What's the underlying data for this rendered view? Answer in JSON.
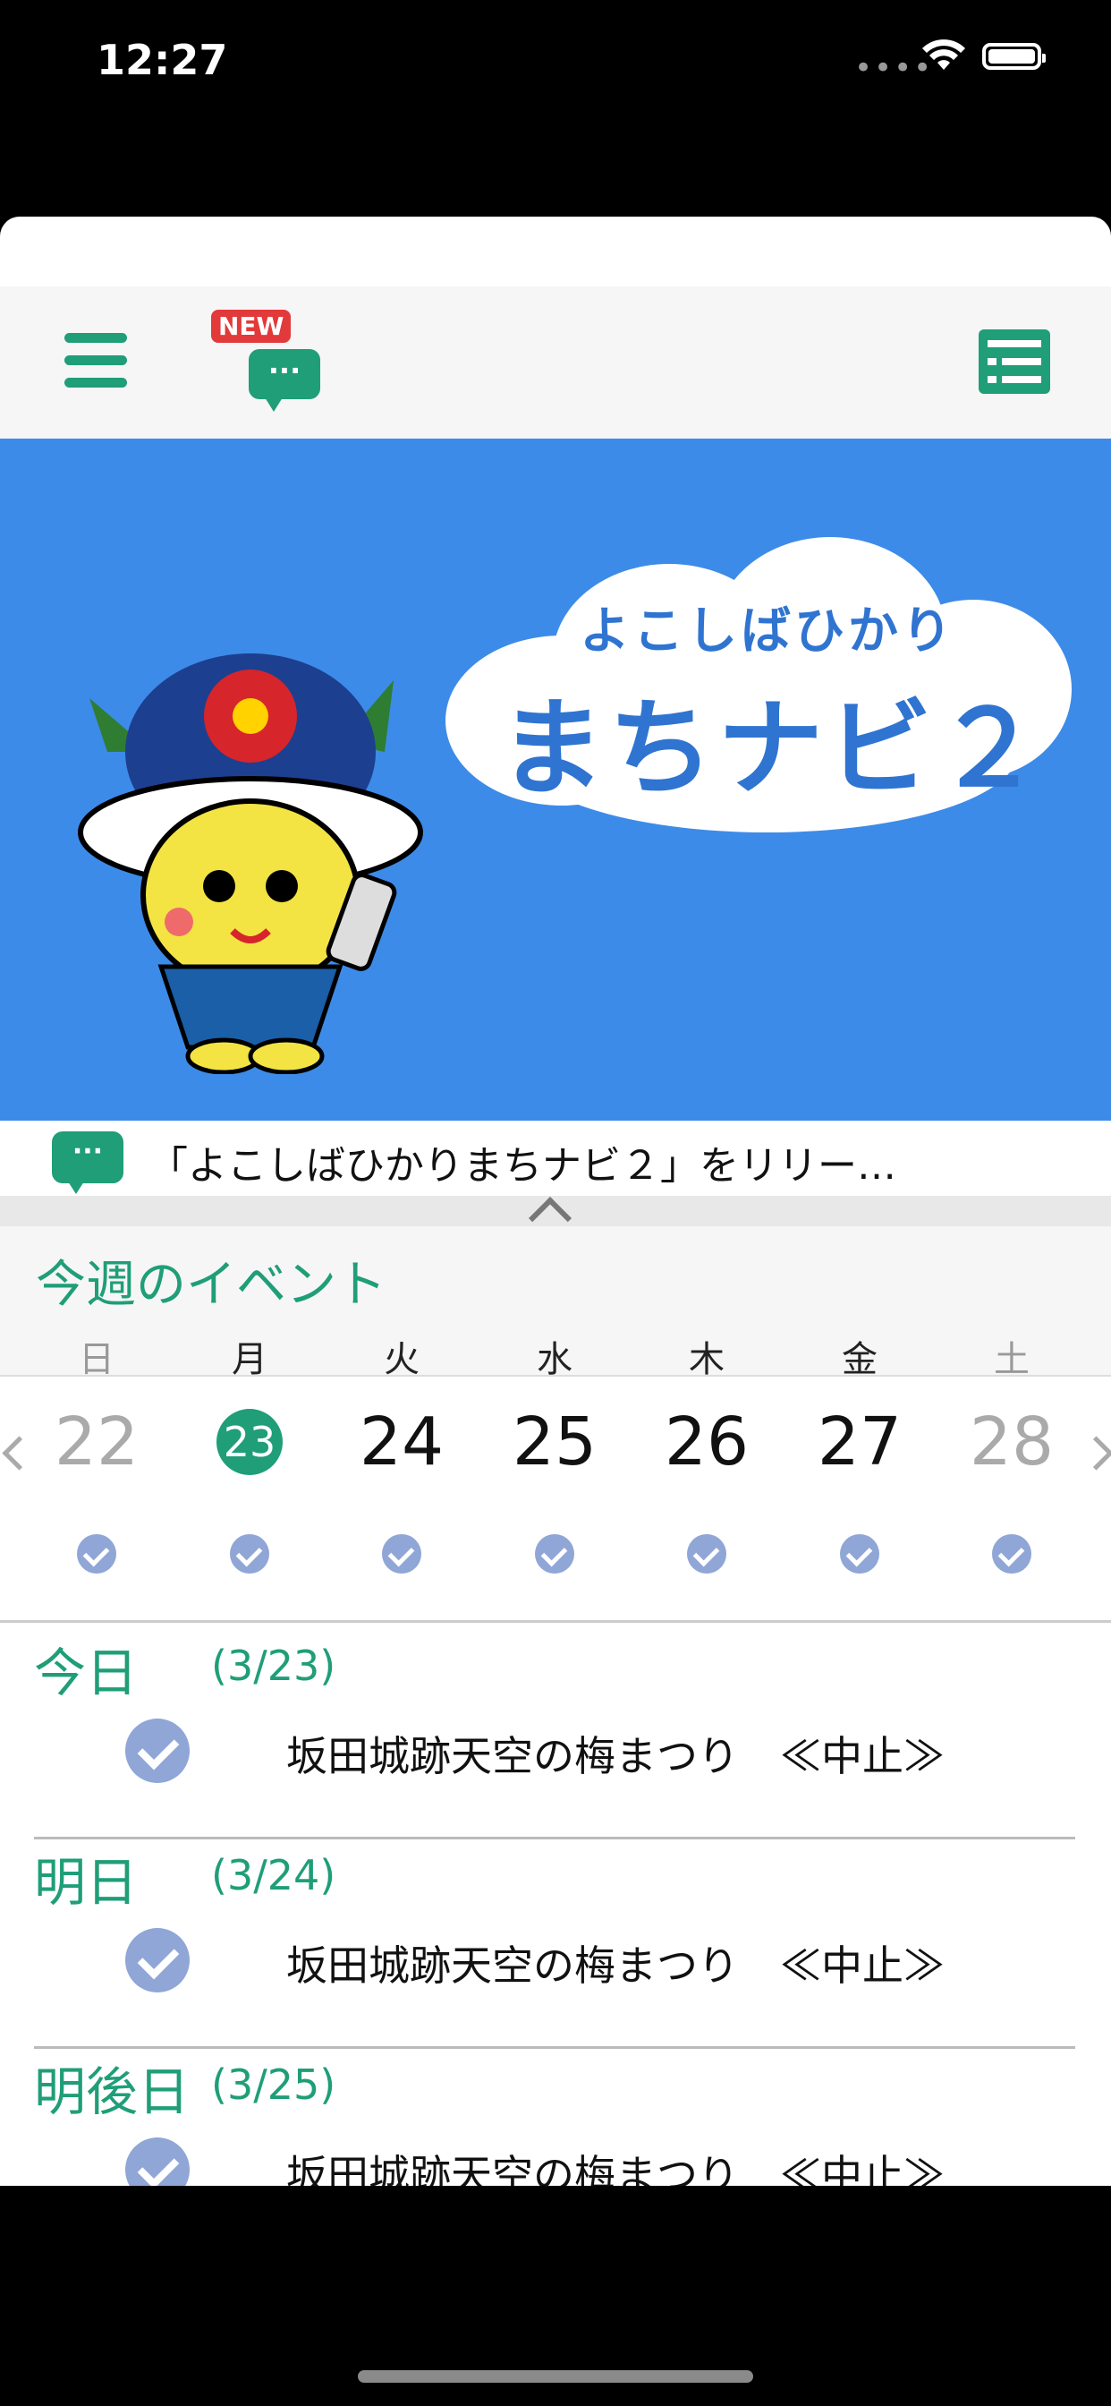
{
  "status_bar": {
    "time": "12:27"
  },
  "toolbar": {
    "new_badge": "NEW",
    "chat_dots": "···"
  },
  "banner": {
    "line1": "よこしばひかり",
    "line2": "まちナビ２"
  },
  "news": {
    "icon_dots": "···",
    "text": "「よこしばひかりまちナビ２」をリリー…"
  },
  "week": {
    "title": "今週のイベント",
    "dows": [
      "日",
      "月",
      "火",
      "水",
      "木",
      "金",
      "土"
    ],
    "days": [
      "22",
      "23",
      "24",
      "25",
      "26",
      "27",
      "28"
    ]
  },
  "events": [
    {
      "label": "今日",
      "date": "(3/23)",
      "title": "坂田城跡天空の梅まつり　≪中止≫"
    },
    {
      "label": "明日",
      "date": "(3/24)",
      "title": "坂田城跡天空の梅まつり　≪中止≫"
    },
    {
      "label": "明後日",
      "date": "(3/25)",
      "title": "坂田城跡天空の梅まつり　≪中止≫"
    }
  ],
  "colors": {
    "accent": "#1f9e78",
    "banner": "#3d8be8",
    "check": "#8fa6d6"
  }
}
